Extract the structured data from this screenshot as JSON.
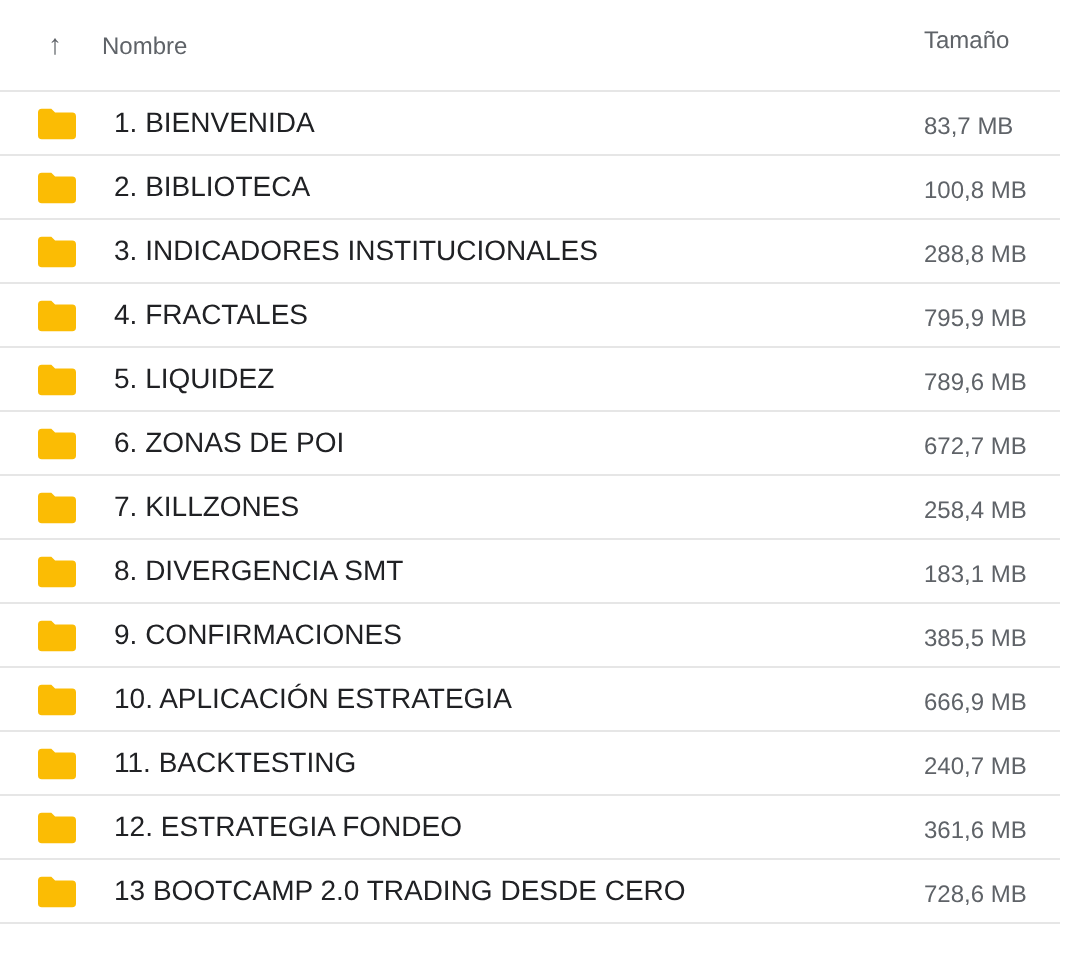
{
  "header": {
    "sort_icon": "↑",
    "columns": [
      "Nombre",
      "Tamaño"
    ]
  },
  "rows": [
    {
      "name": "1. BIENVENIDA",
      "size": "83,7 MB"
    },
    {
      "name": "2. BIBLIOTECA",
      "size": "100,8 MB"
    },
    {
      "name": "3. INDICADORES INSTITUCIONALES",
      "size": "288,8 MB"
    },
    {
      "name": "4. FRACTALES",
      "size": "795,9 MB"
    },
    {
      "name": "5. LIQUIDEZ",
      "size": "789,6 MB"
    },
    {
      "name": "6. ZONAS DE POI",
      "size": "672,7 MB"
    },
    {
      "name": "7. KILLZONES",
      "size": "258,4 MB"
    },
    {
      "name": "8. DIVERGENCIA SMT",
      "size": "183,1 MB"
    },
    {
      "name": "9. CONFIRMACIONES",
      "size": "385,5 MB"
    },
    {
      "name": "10. APLICACIÓN ESTRATEGIA",
      "size": "666,9 MB"
    },
    {
      "name": "11. BACKTESTING",
      "size": "240,7 MB"
    },
    {
      "name": "12. ESTRATEGIA FONDEO",
      "size": "361,6 MB"
    },
    {
      "name": "13 BOOTCAMP 2.0 TRADING DESDE CERO",
      "size": "728,6 MB"
    }
  ]
}
